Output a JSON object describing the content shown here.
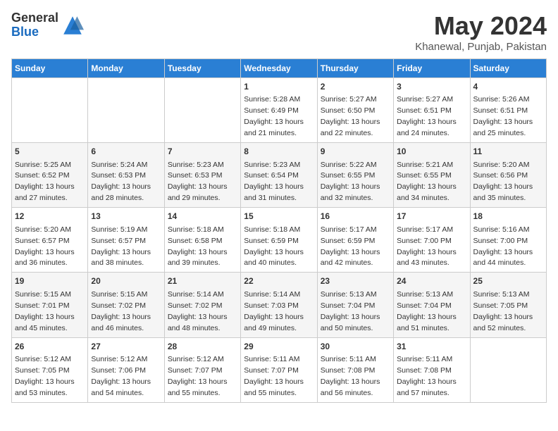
{
  "logo": {
    "general": "General",
    "blue": "Blue"
  },
  "title": "May 2024",
  "location": "Khanewal, Punjab, Pakistan",
  "days_header": [
    "Sunday",
    "Monday",
    "Tuesday",
    "Wednesday",
    "Thursday",
    "Friday",
    "Saturday"
  ],
  "weeks": [
    [
      {
        "day": "",
        "info": ""
      },
      {
        "day": "",
        "info": ""
      },
      {
        "day": "",
        "info": ""
      },
      {
        "day": "1",
        "info": "Sunrise: 5:28 AM\nSunset: 6:49 PM\nDaylight: 13 hours\nand 21 minutes."
      },
      {
        "day": "2",
        "info": "Sunrise: 5:27 AM\nSunset: 6:50 PM\nDaylight: 13 hours\nand 22 minutes."
      },
      {
        "day": "3",
        "info": "Sunrise: 5:27 AM\nSunset: 6:51 PM\nDaylight: 13 hours\nand 24 minutes."
      },
      {
        "day": "4",
        "info": "Sunrise: 5:26 AM\nSunset: 6:51 PM\nDaylight: 13 hours\nand 25 minutes."
      }
    ],
    [
      {
        "day": "5",
        "info": "Sunrise: 5:25 AM\nSunset: 6:52 PM\nDaylight: 13 hours\nand 27 minutes."
      },
      {
        "day": "6",
        "info": "Sunrise: 5:24 AM\nSunset: 6:53 PM\nDaylight: 13 hours\nand 28 minutes."
      },
      {
        "day": "7",
        "info": "Sunrise: 5:23 AM\nSunset: 6:53 PM\nDaylight: 13 hours\nand 29 minutes."
      },
      {
        "day": "8",
        "info": "Sunrise: 5:23 AM\nSunset: 6:54 PM\nDaylight: 13 hours\nand 31 minutes."
      },
      {
        "day": "9",
        "info": "Sunrise: 5:22 AM\nSunset: 6:55 PM\nDaylight: 13 hours\nand 32 minutes."
      },
      {
        "day": "10",
        "info": "Sunrise: 5:21 AM\nSunset: 6:55 PM\nDaylight: 13 hours\nand 34 minutes."
      },
      {
        "day": "11",
        "info": "Sunrise: 5:20 AM\nSunset: 6:56 PM\nDaylight: 13 hours\nand 35 minutes."
      }
    ],
    [
      {
        "day": "12",
        "info": "Sunrise: 5:20 AM\nSunset: 6:57 PM\nDaylight: 13 hours\nand 36 minutes."
      },
      {
        "day": "13",
        "info": "Sunrise: 5:19 AM\nSunset: 6:57 PM\nDaylight: 13 hours\nand 38 minutes."
      },
      {
        "day": "14",
        "info": "Sunrise: 5:18 AM\nSunset: 6:58 PM\nDaylight: 13 hours\nand 39 minutes."
      },
      {
        "day": "15",
        "info": "Sunrise: 5:18 AM\nSunset: 6:59 PM\nDaylight: 13 hours\nand 40 minutes."
      },
      {
        "day": "16",
        "info": "Sunrise: 5:17 AM\nSunset: 6:59 PM\nDaylight: 13 hours\nand 42 minutes."
      },
      {
        "day": "17",
        "info": "Sunrise: 5:17 AM\nSunset: 7:00 PM\nDaylight: 13 hours\nand 43 minutes."
      },
      {
        "day": "18",
        "info": "Sunrise: 5:16 AM\nSunset: 7:00 PM\nDaylight: 13 hours\nand 44 minutes."
      }
    ],
    [
      {
        "day": "19",
        "info": "Sunrise: 5:15 AM\nSunset: 7:01 PM\nDaylight: 13 hours\nand 45 minutes."
      },
      {
        "day": "20",
        "info": "Sunrise: 5:15 AM\nSunset: 7:02 PM\nDaylight: 13 hours\nand 46 minutes."
      },
      {
        "day": "21",
        "info": "Sunrise: 5:14 AM\nSunset: 7:02 PM\nDaylight: 13 hours\nand 48 minutes."
      },
      {
        "day": "22",
        "info": "Sunrise: 5:14 AM\nSunset: 7:03 PM\nDaylight: 13 hours\nand 49 minutes."
      },
      {
        "day": "23",
        "info": "Sunrise: 5:13 AM\nSunset: 7:04 PM\nDaylight: 13 hours\nand 50 minutes."
      },
      {
        "day": "24",
        "info": "Sunrise: 5:13 AM\nSunset: 7:04 PM\nDaylight: 13 hours\nand 51 minutes."
      },
      {
        "day": "25",
        "info": "Sunrise: 5:13 AM\nSunset: 7:05 PM\nDaylight: 13 hours\nand 52 minutes."
      }
    ],
    [
      {
        "day": "26",
        "info": "Sunrise: 5:12 AM\nSunset: 7:05 PM\nDaylight: 13 hours\nand 53 minutes."
      },
      {
        "day": "27",
        "info": "Sunrise: 5:12 AM\nSunset: 7:06 PM\nDaylight: 13 hours\nand 54 minutes."
      },
      {
        "day": "28",
        "info": "Sunrise: 5:12 AM\nSunset: 7:07 PM\nDaylight: 13 hours\nand 55 minutes."
      },
      {
        "day": "29",
        "info": "Sunrise: 5:11 AM\nSunset: 7:07 PM\nDaylight: 13 hours\nand 55 minutes."
      },
      {
        "day": "30",
        "info": "Sunrise: 5:11 AM\nSunset: 7:08 PM\nDaylight: 13 hours\nand 56 minutes."
      },
      {
        "day": "31",
        "info": "Sunrise: 5:11 AM\nSunset: 7:08 PM\nDaylight: 13 hours\nand 57 minutes."
      },
      {
        "day": "",
        "info": ""
      }
    ]
  ]
}
